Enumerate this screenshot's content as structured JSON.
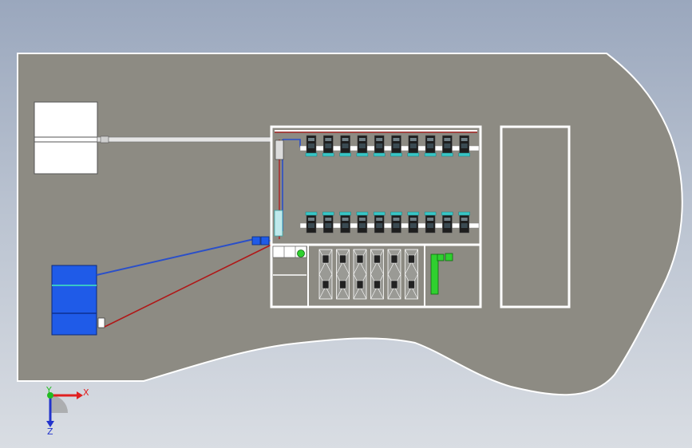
{
  "viewport": {
    "background_top": "#9aa7bd",
    "background_bottom": "#d9dde3",
    "site_fill": "#8d8b83",
    "site_edge": "#ffffff"
  },
  "triad": {
    "x_label": "X",
    "y_label": "Y",
    "z_label": "Z",
    "x_color": "#e02020",
    "y_color": "#22bb22",
    "z_color": "#2233cc"
  },
  "components": {
    "upper_rack_units": 10,
    "lower_rack_units": 10,
    "chiller_units": 6,
    "colors": {
      "pipe_supply": "#2a4fc9",
      "pipe_return": "#b01818",
      "tank_blue": "#1f5be8",
      "pump_green": "#2fd02f",
      "accent_cyan": "#39c6c6"
    }
  }
}
